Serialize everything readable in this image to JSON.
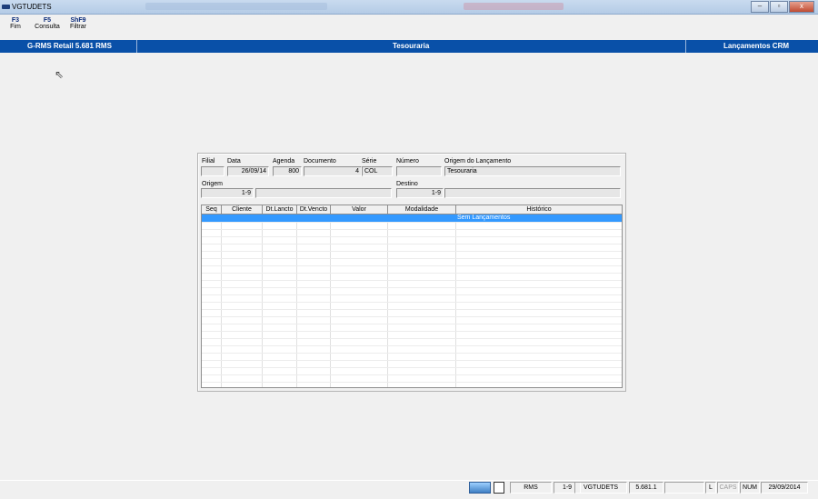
{
  "window": {
    "title": "VGTUDETS",
    "minimize": "–",
    "restore": "▫",
    "close": "x"
  },
  "toolbar": [
    {
      "key": "F3",
      "label": "Fim"
    },
    {
      "key": "F5",
      "label": "Consulta"
    },
    {
      "key": "ShF9",
      "label": "Filtrar"
    }
  ],
  "header": {
    "left": "G-RMS Retail 5.681 RMS",
    "center": "Tesouraria",
    "right": "Lançamentos CRM"
  },
  "form": {
    "filial_label": "Filial",
    "filial_value": "",
    "data_label": "Data",
    "data_value": "26/09/14",
    "agenda_label": "Agenda",
    "agenda_value": "800",
    "documento_label": "Documento",
    "documento_value": "4",
    "serie_label": "Série",
    "serie_value": "COL",
    "numero_label": "Número",
    "numero_value": "",
    "origem_lanc_label": "Origem do Lançamento",
    "origem_lanc_value": "Tesouraria",
    "origem_label": "Origem",
    "origem_code": "1-9",
    "origem_desc": "",
    "destino_label": "Destino",
    "destino_code": "1-9",
    "destino_desc": ""
  },
  "grid": {
    "columns": [
      "Seq",
      "Cliente",
      "Dt.Lancto",
      "Dt.Vencto",
      "Valor",
      "Modalidade",
      "Histórico"
    ],
    "selected_row_text": "Sem Lançamentos"
  },
  "status": {
    "user": "RMS",
    "range": "1-9",
    "program": "VGTUDETS",
    "version": "5.681.1",
    "l": "L",
    "caps": "CAPS",
    "num": "NUM",
    "date": "29/09/2014"
  }
}
